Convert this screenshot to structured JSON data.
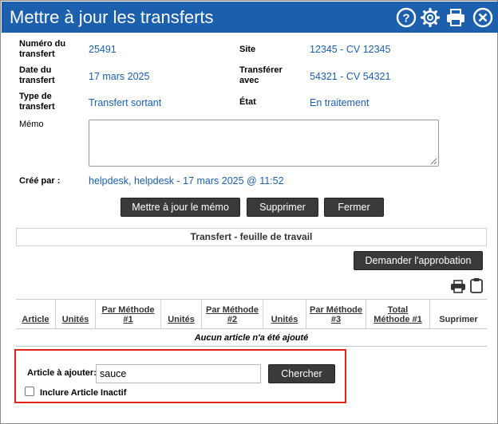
{
  "window": {
    "title": "Mettre à jour les transferts",
    "icons": [
      "help-icon",
      "gear-icon",
      "print-icon",
      "close-icon"
    ],
    "title_bg": "#1b5fad"
  },
  "fields": {
    "transfer_number_label": "Numéro du transfert",
    "transfer_number_value": "25491",
    "site_label": "Site",
    "site_value": "12345 - CV 12345",
    "transfer_date_label": "Date du transfert",
    "transfer_date_value": "17 mars 2025",
    "transfer_with_label": "Transférer avec",
    "transfer_with_value": "54321 - CV 54321",
    "transfer_type_label": "Type de transfert",
    "transfer_type_value": "Transfert sortant",
    "state_label": "État",
    "state_value": "En traitement",
    "memo_label": "Mémo",
    "memo_value": "",
    "created_by_label": "Créé par :",
    "created_by_value": "helpdesk, helpdesk - 17 mars 2025 @ 11:52"
  },
  "actions": {
    "update_memo": "Mettre à jour le mémo",
    "delete": "Supprimer",
    "close": "Fermer"
  },
  "worksheet": {
    "title": "Transfert - feuille de travail",
    "request_approval": "Demander l'approbation",
    "columns": [
      "Article",
      "Unités",
      "Par Méthode #1",
      "Unités",
      "Par Méthode #2",
      "Unités",
      "Par Méthode #3",
      "Total Méthode #1",
      "Suprimer"
    ],
    "empty_message": "Aucun article n'a été ajouté"
  },
  "add_item": {
    "label": "Article à ajouter:",
    "value": "sauce",
    "search_button": "Chercher",
    "include_inactive_label": "Inclure Article Inactif",
    "include_inactive_checked": false
  }
}
